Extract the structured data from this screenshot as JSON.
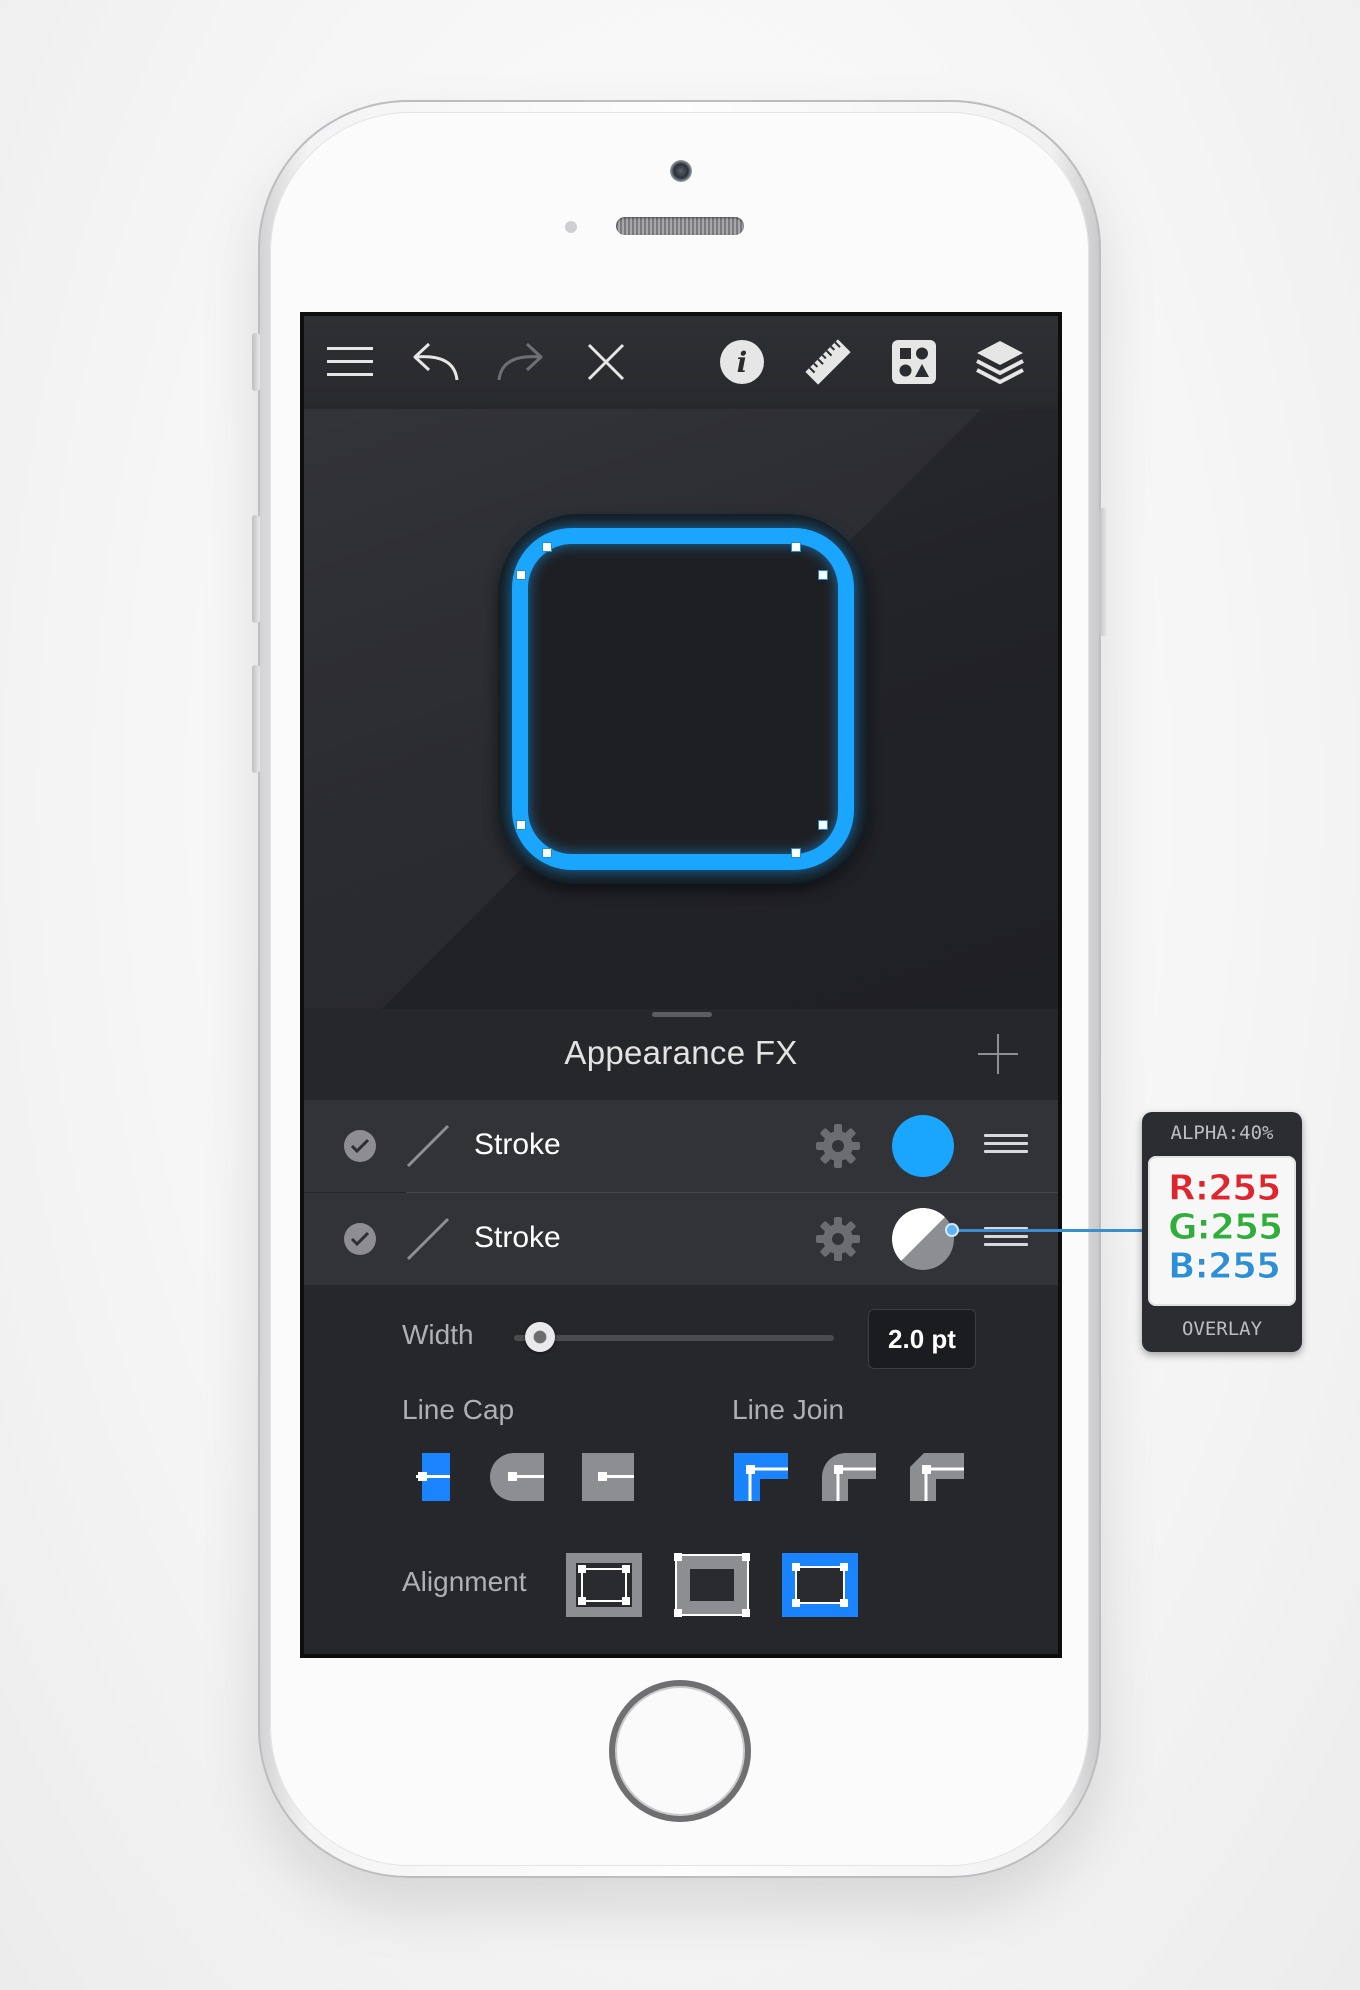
{
  "toolbar": {
    "icons": [
      "menu-icon",
      "undo-icon",
      "redo-icon",
      "close-icon",
      "info-icon",
      "ruler-icon",
      "library-icon",
      "layers-icon"
    ]
  },
  "canvas": {
    "shape_color": "#1aa5ff"
  },
  "panel": {
    "title": "Appearance FX",
    "add_icon": "plus-icon",
    "effects": [
      {
        "label": "Stroke",
        "enabled": true,
        "swatch": "#1aa5ff"
      },
      {
        "label": "Stroke",
        "enabled": true,
        "swatch": "half-white-gray"
      }
    ],
    "width": {
      "label": "Width",
      "value": "2.0 pt",
      "slider_fraction": 0.05
    },
    "line_cap": {
      "label": "Line Cap",
      "options": [
        "butt-cap-icon",
        "round-cap-icon",
        "square-cap-icon"
      ],
      "selected": 0
    },
    "line_join": {
      "label": "Line Join",
      "options": [
        "miter-join-icon",
        "round-join-icon",
        "bevel-join-icon"
      ],
      "selected": 0
    },
    "alignment": {
      "label": "Alignment",
      "options": [
        "align-center-icon",
        "align-inside-icon",
        "align-outside-icon"
      ],
      "selected": 2
    }
  },
  "overlay_callout": {
    "alpha_label": "ALPHA:40%",
    "r": "R:255",
    "g": "G:255",
    "b": "B:255",
    "blend_mode": "OVERLAY",
    "colors": {
      "r": "#e0262c",
      "g": "#2fae3a",
      "b": "#2d8fd6"
    }
  }
}
